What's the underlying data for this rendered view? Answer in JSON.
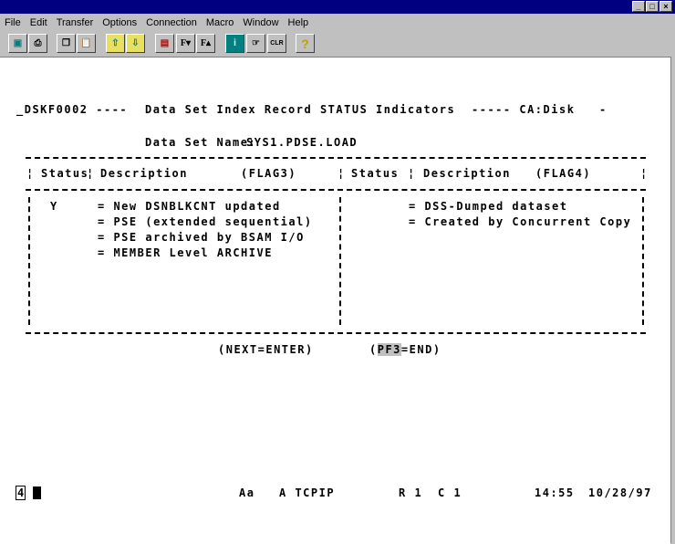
{
  "window": {
    "buttons": [
      "_",
      "□",
      "×"
    ]
  },
  "menu": [
    "File",
    "Edit",
    "Transfer",
    "Options",
    "Connection",
    "Macro",
    "Window",
    "Help"
  ],
  "toolbar": [
    {
      "icon": "display-icon",
      "label": "▣"
    },
    {
      "icon": "print-icon",
      "label": "⎙"
    },
    {
      "icon": "copy-icon",
      "label": "❐"
    },
    {
      "icon": "paste-icon",
      "label": "📋"
    },
    {
      "icon": "send-file-icon",
      "label": "⇧"
    },
    {
      "icon": "receive-file-icon",
      "label": "⇩"
    },
    {
      "icon": "color-palette-icon",
      "label": "▤"
    },
    {
      "icon": "font-smaller-icon",
      "label": "F▾"
    },
    {
      "icon": "font-larger-icon",
      "label": "F▴"
    },
    {
      "icon": "info-icon",
      "label": "i"
    },
    {
      "icon": "pointer-hand-icon",
      "label": "☞"
    },
    {
      "icon": "clear-icon",
      "label": "CLR"
    },
    {
      "icon": "help-icon",
      "label": "?"
    }
  ],
  "screen": {
    "panel_id": "_DSKF0002 ----",
    "title": "Data Set Index Record STATUS Indicators",
    "product": "----- CA:Disk",
    "trail_dash": "-",
    "dsn_label": "Data Set Name:",
    "dsn_value": "SYS1.PDSE.LOAD",
    "headers": {
      "status_left": "Status",
      "desc_left": "Description",
      "flag_left": "(FLAG3)",
      "status_right": "Status",
      "desc_right": "Description",
      "flag_right": "(FLAG4)",
      "sep": "¦"
    },
    "left_rows": [
      {
        "status": "Y",
        "desc": "= New DSNBLKCNT updated"
      },
      {
        "status": "",
        "desc": "= PSE (extended sequential)"
      },
      {
        "status": "",
        "desc": "= PSE archived by BSAM I/O"
      },
      {
        "status": "",
        "desc": "= MEMBER Level ARCHIVE"
      }
    ],
    "right_rows": [
      {
        "status": "",
        "desc": "= DSS-Dumped dataset"
      },
      {
        "status": "",
        "desc": "= Created by Concurrent Copy"
      }
    ],
    "next_key": "(NEXT=ENTER)",
    "end_key_open": "(",
    "end_key_pf": "PF3",
    "end_key_rest": "=END)"
  },
  "oia": {
    "session": "4",
    "mode": "Aa",
    "connection": "A TCPIP",
    "row": "R 1",
    "col": "C 1",
    "time": "14:55",
    "date": "10/28/97"
  }
}
